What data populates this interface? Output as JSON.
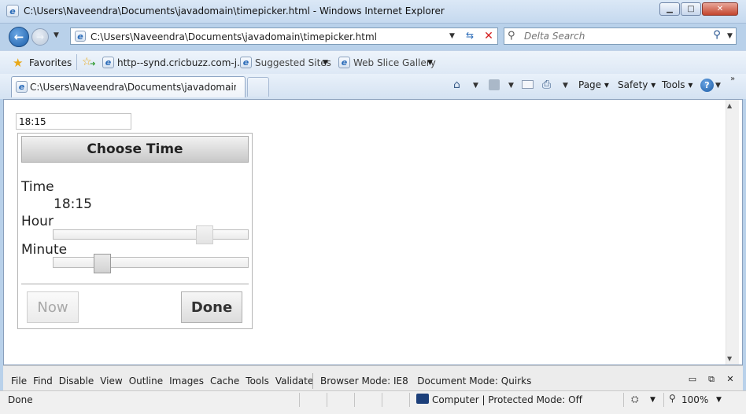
{
  "window": {
    "title": "C:\\Users\\Naveendra\\Documents\\javadomain\\timepicker.html - Windows Internet Explorer",
    "minimize": "▁",
    "maximize": "□",
    "close": "✕"
  },
  "navigation": {
    "back": "←",
    "forward": "→",
    "address": "C:\\Users\\Naveendra\\Documents\\javadomain\\timepicker.html",
    "search_placeholder": "Delta Search"
  },
  "favorites_bar": {
    "favorites_label": "Favorites",
    "items": [
      {
        "label": "http--synd.cricbuzz.com-j...",
        "icon": "ie-page-icon"
      },
      {
        "label": "Suggested Sites",
        "icon": "ie-page-icon"
      },
      {
        "label": "Web Slice Gallery",
        "icon": "ie-page-icon"
      }
    ]
  },
  "tab_bar": {
    "active_tab": "C:\\Users\\Naveendra\\Documents\\javadomain\\ti...",
    "menus": {
      "page": "Page",
      "safety": "Safety",
      "tools": "Tools"
    },
    "help": "?"
  },
  "page": {
    "time_input_value": "18:15",
    "picker": {
      "header": "Choose Time",
      "time_label": "Time",
      "time_value": "18:15",
      "hour_label": "Hour",
      "hour_value": 18,
      "minute_label": "Minute",
      "minute_value": 15,
      "now_button": "Now",
      "done_button": "Done"
    }
  },
  "dev_toolbar": {
    "menu": [
      "File",
      "Find",
      "Disable",
      "View",
      "Outline",
      "Images",
      "Cache",
      "Tools",
      "Validate"
    ],
    "browser_mode_label": "Browser Mode:",
    "browser_mode_value": "IE8",
    "document_mode_label": "Document Mode:",
    "document_mode_value": "Quirks"
  },
  "status_bar": {
    "status": "Done",
    "zone": "Computer | Protected Mode: Off",
    "zoom": "100%"
  },
  "colors": {
    "frame": "#b9d1ea",
    "header_gradient_top": "#f2f2f2",
    "header_gradient_bottom": "#c8c8c8",
    "close_button": "#c3452d"
  }
}
